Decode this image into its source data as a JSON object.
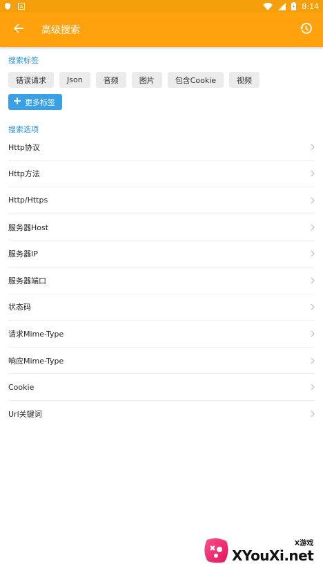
{
  "status_bar": {
    "time": "8:14"
  },
  "app_bar": {
    "title": "高级搜索",
    "back_icon": "arrow-back-icon",
    "history_icon": "history-icon"
  },
  "tags_section": {
    "title": "搜索标签",
    "tags": [
      "错误请求",
      "Json",
      "音频",
      "图片",
      "包含Cookie",
      "视频"
    ],
    "more_label": "更多标签"
  },
  "options_section": {
    "title": "搜索选项",
    "items": [
      "Http协议",
      "Http方法",
      "Http/Https",
      "服务器Host",
      "服务器IP",
      "服务器端口",
      "状态码",
      "请求Mime-Type",
      "响应Mime-Type",
      "Cookie",
      "Url关键词"
    ]
  },
  "watermark": {
    "small": "X游戏",
    "big": "XYouXi.net"
  },
  "colors": {
    "primary": "#ffa20d",
    "accent": "#2d8fd6",
    "button": "#3aa0e6"
  }
}
